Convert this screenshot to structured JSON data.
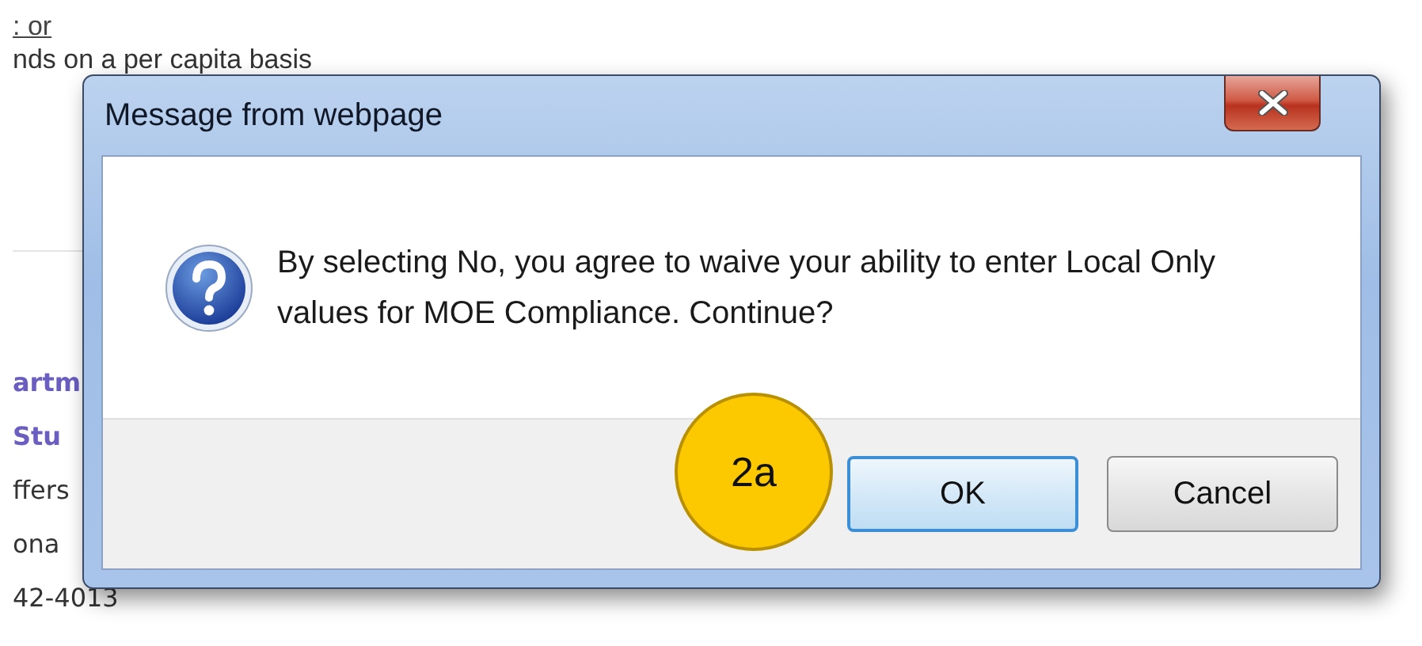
{
  "background_page": {
    "link": ": or",
    "line": "nds on a per capita basis",
    "left_column": [
      {
        "text": "artm",
        "kind": "heading"
      },
      {
        "text": "Stu",
        "kind": "heading"
      },
      {
        "text": "ffers",
        "kind": "plain"
      },
      {
        "text": "ona",
        "kind": "plain"
      },
      {
        "text": "42-4013",
        "kind": "plain"
      }
    ]
  },
  "dialog": {
    "title": "Message from webpage",
    "message": "By selecting No, you agree to waive your ability to enter Local Only values for MOE Compliance. Continue?",
    "buttons": [
      {
        "label": "OK",
        "selected": true
      },
      {
        "label": "Cancel",
        "selected": false
      }
    ]
  },
  "annotation": {
    "label": "2a"
  }
}
